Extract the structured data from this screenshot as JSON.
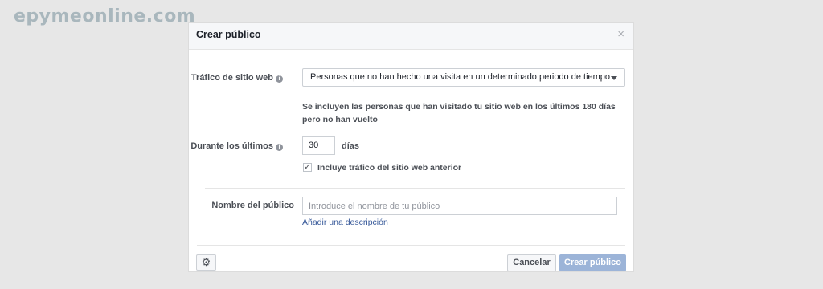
{
  "watermark": "epymeonline.com",
  "dialog": {
    "title": "Crear público",
    "close_glyph": "×"
  },
  "website_traffic": {
    "label": "Tráfico de sitio web",
    "selected": "Personas que no han hecho una visita en un determinado periodo de tiempo",
    "description": "Se incluyen las personas que han visitado tu sitio web en los últimos 180 días pero no han vuelto"
  },
  "duration": {
    "label": "Durante los últimos",
    "value": "30",
    "unit": "días",
    "checkbox_label": "Incluye tráfico del sitio web anterior",
    "checked": true
  },
  "audience_name": {
    "label": "Nombre del público",
    "placeholder": "Introduce el nombre de tu público",
    "add_description": "Añadir una descripción"
  },
  "footer": {
    "cancel_label": "Cancelar",
    "create_label": "Crear público"
  },
  "icons": {
    "info": "info-icon",
    "close": "close-icon",
    "caret": "caret-down-icon",
    "check": "check-icon",
    "gear": "gear-icon"
  },
  "colors": {
    "page_bg": "#e7e7e7",
    "header_bg": "#f6f7f9",
    "link": "#365899",
    "primary_disabled": "#9cb4d8",
    "watermark": "#a9b7bd"
  }
}
